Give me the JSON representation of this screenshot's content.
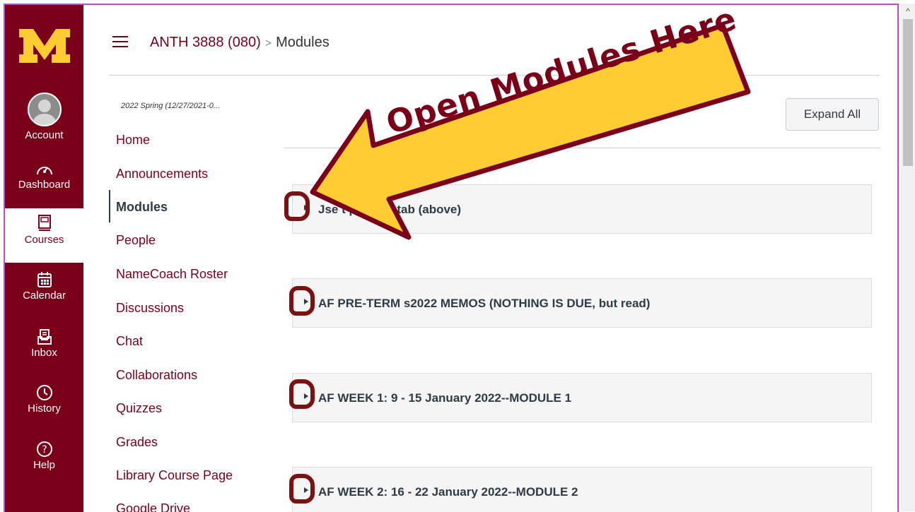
{
  "nav": {
    "account": "Account",
    "dashboard": "Dashboard",
    "courses": "Courses",
    "calendar": "Calendar",
    "inbox": "Inbox",
    "history": "History",
    "help": "Help"
  },
  "breadcrumb": {
    "course": "ANTH 3888 (080)",
    "separator": ">",
    "page": "Modules"
  },
  "term": "2022 Spring (12/27/2021-0...",
  "course_nav": [
    "Home",
    "Announcements",
    "Modules",
    "People",
    "NameCoach Roster",
    "Discussions",
    "Chat",
    "Collaborations",
    "Quizzes",
    "Grades",
    "Library Course Page",
    "Google Drive"
  ],
  "expand_all": "Expand All",
  "modules": [
    "Jse t          pse All\" tab (above)",
    "AF PRE-TERM s2022 MEMOS (NOTHING IS DUE, but read)",
    "AF WEEK 1: 9 - 15 January 2022--MODULE 1",
    "AF WEEK 2: 16 - 22 January 2022--MODULE 2"
  ],
  "annotation": "Open Modules Here",
  "colors": {
    "maroon": "#7a0019",
    "gold": "#ffcc33",
    "text": "#2d3b45",
    "annotation_circle": "#7a1212"
  }
}
